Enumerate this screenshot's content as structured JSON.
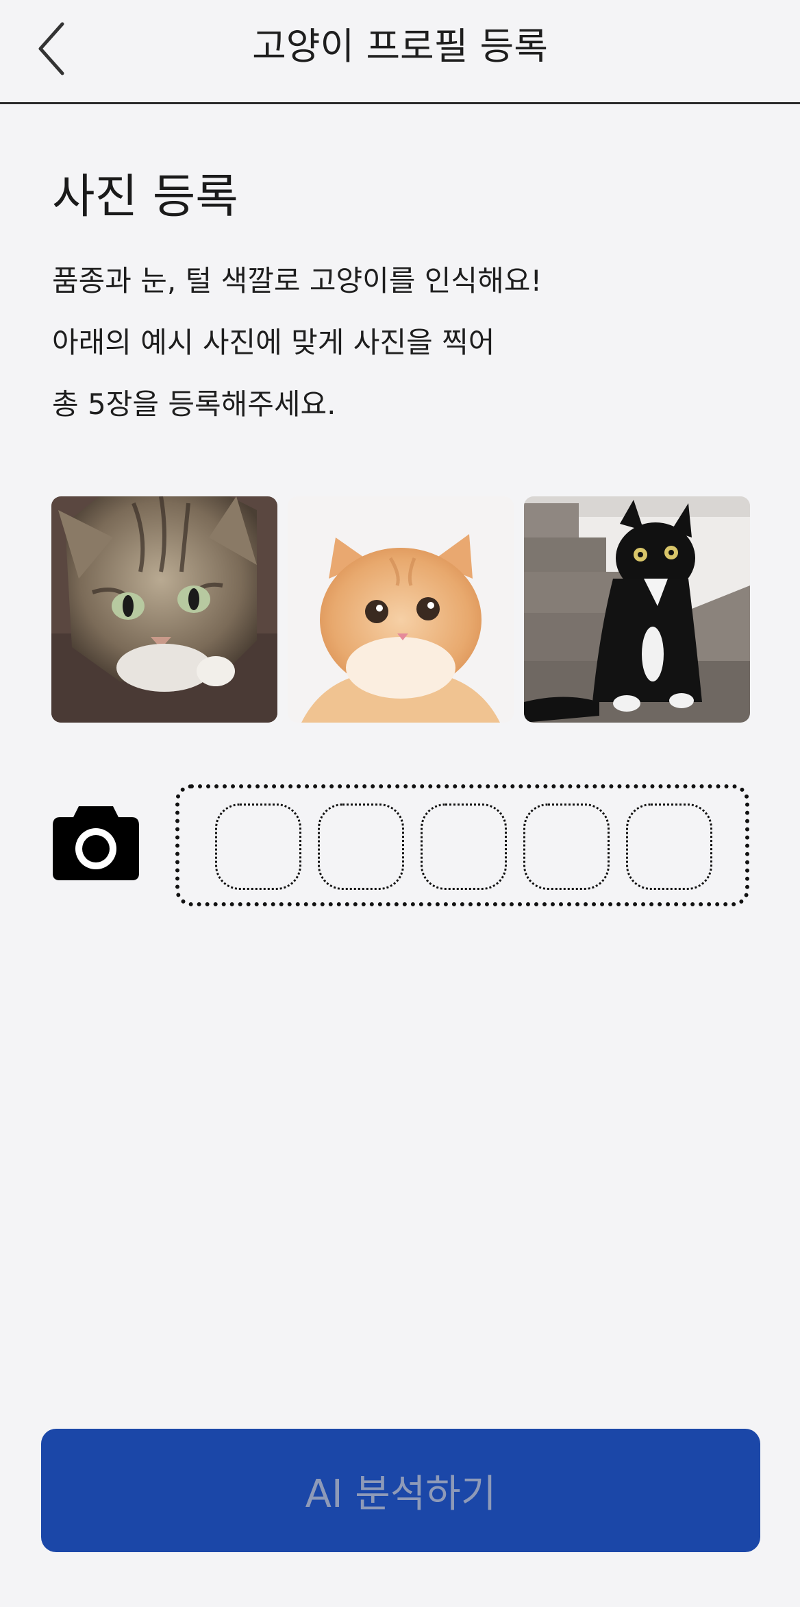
{
  "header": {
    "title": "고양이 프로필 등록",
    "back_icon": "chevron-left-icon"
  },
  "section": {
    "title": "사진 등록",
    "description": [
      "품종과 눈, 털 색깔로 고양이를 인식해요!",
      "아래의 예시 사진에 맞게 사진을 찍어",
      "총 5장을 등록해주세요."
    ]
  },
  "examples": [
    {
      "subject": "tabby cat top view",
      "icon": "example-photo"
    },
    {
      "subject": "orange cat front view",
      "icon": "example-photo"
    },
    {
      "subject": "black and white cat full body",
      "icon": "example-photo"
    }
  ],
  "upload": {
    "camera_icon": "camera-icon",
    "slot_count": 5,
    "filled_count": 0
  },
  "footer": {
    "button_label": "AI 분석하기",
    "button_color": "#1b47a8",
    "button_text_color": "#8e9ab8"
  }
}
